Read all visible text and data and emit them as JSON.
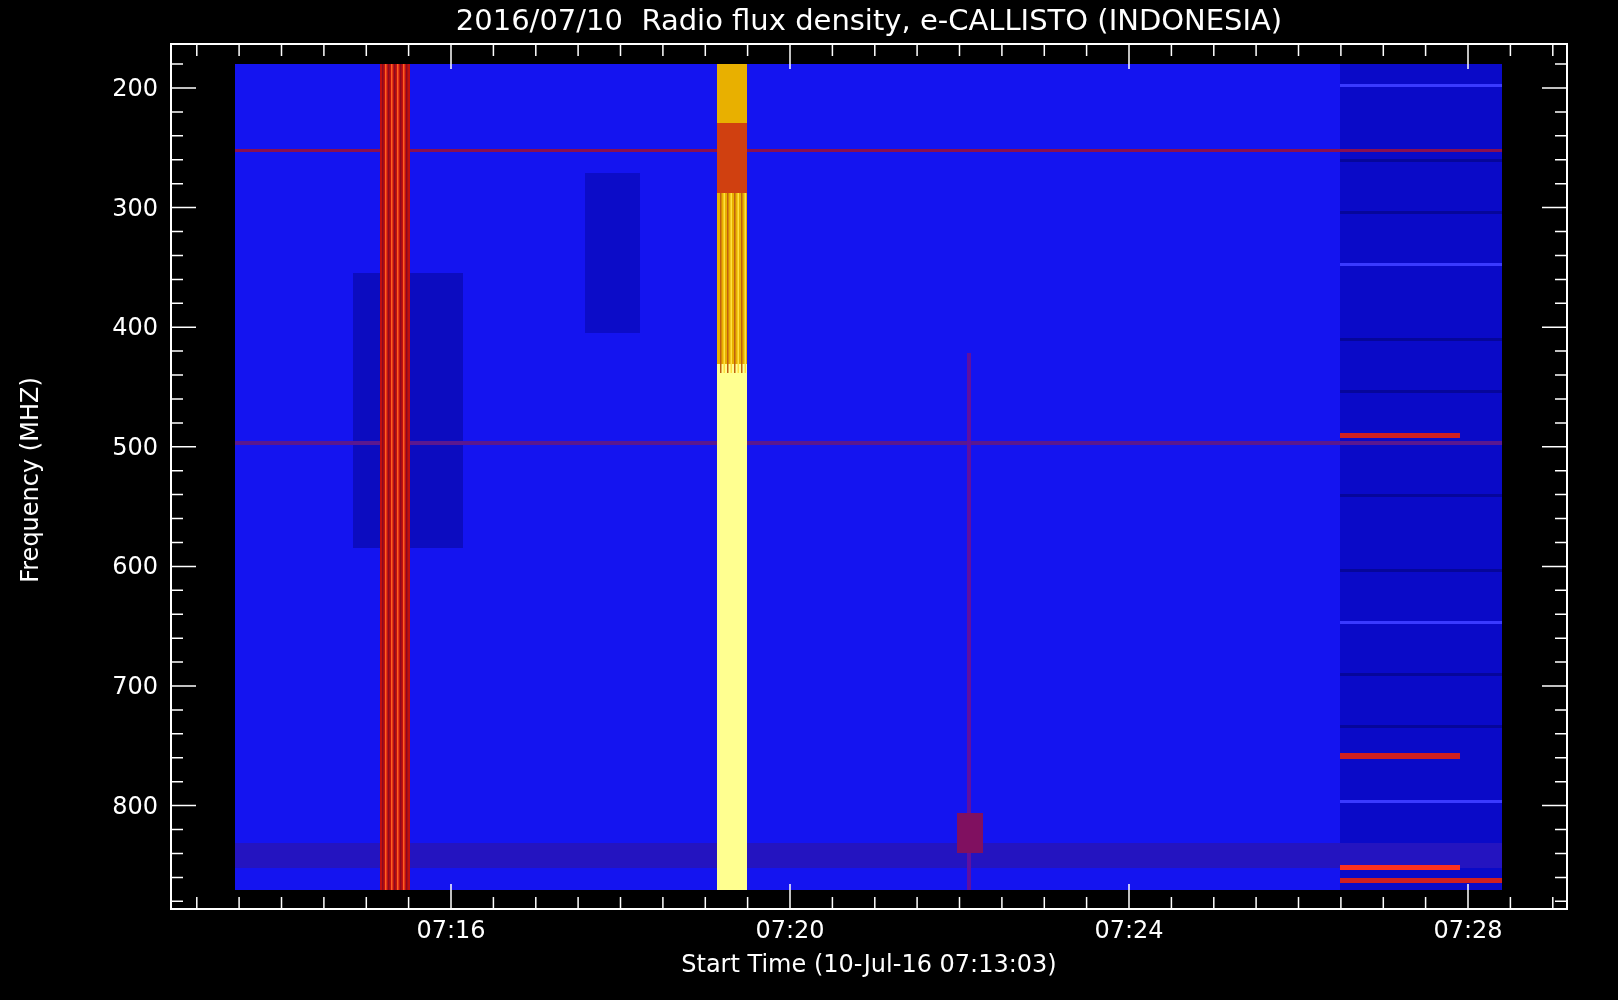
{
  "title": "2016/07/10  Radio flux density, e-CALLISTO (INDONESIA)",
  "y_axis": {
    "label": "Frequency (MHZ)",
    "tick_labels": [
      "200",
      "300",
      "400",
      "500",
      "600",
      "700",
      "800"
    ]
  },
  "x_axis": {
    "label": "Start Time (10-Jul-16 07:13:03)",
    "tick_labels": [
      "07:16",
      "07:20",
      "07:24",
      "07:28"
    ]
  }
}
